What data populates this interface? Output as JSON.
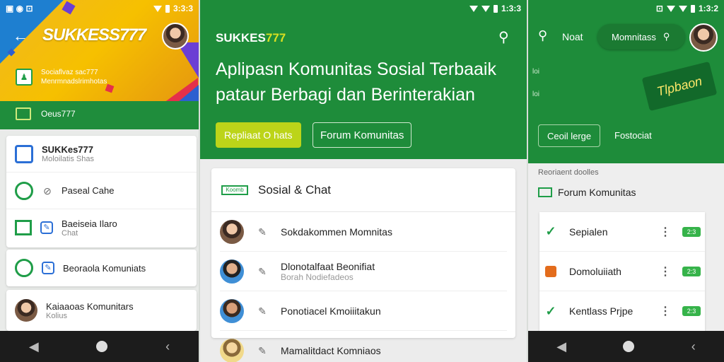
{
  "status": {
    "s1_time": "3:3:3",
    "s2_time": "1:3:3",
    "s3_time": "1:3:2"
  },
  "screen1": {
    "brand": "SUKKESS777",
    "header_line1": "Sociaflvaz sac777",
    "header_line2": "Menrmnadslrimhotas",
    "band_item": "Oeus777",
    "card1": {
      "title": "SUKKes777",
      "subtitle": "Moloilatis Shas",
      "row2": "Paseal Cahe",
      "row3_title": "Baeiseia Ilaro",
      "row3_sub": "Chat"
    },
    "card2": {
      "row": "Beoraola Komuniats"
    },
    "card3": {
      "title": "Kaiaaoas Komunitars",
      "subtitle": "Kolius"
    }
  },
  "screen2": {
    "brand_main": "SUKKES",
    "brand_accent": "777",
    "headline": "Aplipasn Komunitas Sosial Terbaaik pataur Berbagi dan Berinterakian",
    "btn_primary": "Repliaat O hats",
    "btn_secondary": "Forum Komunitas",
    "panel_title": "Sosial & Chat",
    "panel_tag": "Koomb",
    "rows": [
      {
        "title": "Sokdakommen Momnitas",
        "subtitle": ""
      },
      {
        "title": "Dlonotalfaat Beonifiat",
        "subtitle": "Borah Nodiefadeos"
      },
      {
        "title": "Ponotiacel Kmoiiitakun",
        "subtitle": ""
      },
      {
        "title": "Mamalitdact Komniaos",
        "subtitle": ""
      }
    ]
  },
  "screen3": {
    "search_label": "Noat",
    "pill_label": "Momnitass",
    "sticker": "Tlpbaon",
    "small_a": "loi",
    "small_b": "loi",
    "btn": "Ceoil lerge",
    "link": "Fostociat",
    "section": "Reoriaent doolles",
    "heading": "Forum Komunitas",
    "rows": [
      {
        "title": "Sepialen",
        "badge": "2:3"
      },
      {
        "title": "Domoluiiath",
        "badge": "2:3"
      },
      {
        "title": "Kentlass Prjpe",
        "badge": "2:3"
      }
    ]
  }
}
